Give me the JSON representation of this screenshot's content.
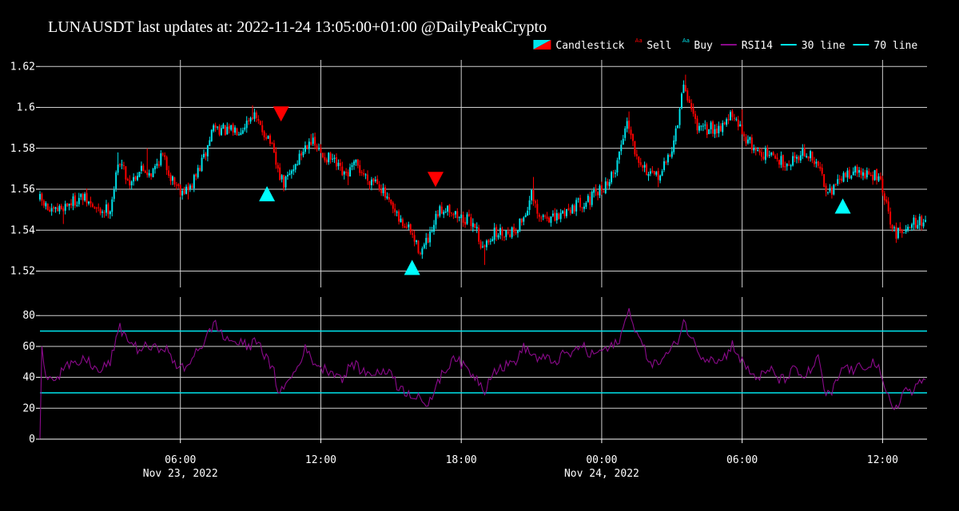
{
  "title": "LUNAUSDT last updates at: 2022-11-24 13:05:00+01:00 @DailyPeakCrypto",
  "legend": [
    {
      "label": "Candlestick",
      "kind": "candle"
    },
    {
      "label": "Sell",
      "kind": "sell"
    },
    {
      "label": "Buy",
      "kind": "buy"
    },
    {
      "label": "RSI14",
      "kind": "rsi"
    },
    {
      "label": "30 line",
      "kind": "hline"
    },
    {
      "label": "70 line",
      "kind": "hline"
    }
  ],
  "colors": {
    "background": "#000000",
    "up": "#00e5ee",
    "down": "#ff0000",
    "buy_marker": "#00ffff",
    "sell_marker": "#ff0000",
    "rsi": "#8b0a8b",
    "hline": "#00e5ee",
    "grid": "#cfcfcf",
    "text": "#ffffff"
  },
  "x_axis": {
    "ticks": [
      {
        "label": "06:00",
        "sub": "Nov 23, 2022",
        "h": 30
      },
      {
        "label": "12:00",
        "sub": "",
        "h": 36
      },
      {
        "label": "18:00",
        "sub": "",
        "h": 42
      },
      {
        "label": "00:00",
        "sub": "Nov 24, 2022",
        "h": 48
      },
      {
        "label": "06:00",
        "sub": "",
        "h": 54
      },
      {
        "label": "12:00",
        "sub": "",
        "h": 60
      }
    ]
  },
  "chart_data": [
    {
      "type": "candlestick",
      "name": "Candlestick",
      "x_range_hours": [
        24.0,
        61.9
      ],
      "x_unit": "hours since 2022-11-22 00:00",
      "ylim": [
        1.512,
        1.624
      ],
      "y_ticks": [
        "1.62",
        "1.6",
        "1.58",
        "1.56",
        "1.54",
        "1.52"
      ],
      "grid": true,
      "interval_minutes": 5,
      "close_path": [
        [
          24.0,
          1.555
        ],
        [
          24.5,
          1.548
        ],
        [
          25.2,
          1.553
        ],
        [
          25.8,
          1.556
        ],
        [
          26.5,
          1.549
        ],
        [
          27.0,
          1.551
        ],
        [
          27.4,
          1.575
        ],
        [
          27.8,
          1.563
        ],
        [
          28.3,
          1.57
        ],
        [
          28.8,
          1.568
        ],
        [
          29.2,
          1.577
        ],
        [
          29.6,
          1.566
        ],
        [
          30.0,
          1.56
        ],
        [
          30.4,
          1.56
        ],
        [
          30.8,
          1.57
        ],
        [
          31.1,
          1.578
        ],
        [
          31.4,
          1.591
        ],
        [
          32.0,
          1.588
        ],
        [
          32.6,
          1.59
        ],
        [
          33.1,
          1.597
        ],
        [
          33.4,
          1.59
        ],
        [
          33.8,
          1.585
        ],
        [
          34.1,
          1.571
        ],
        [
          34.4,
          1.562
        ],
        [
          34.8,
          1.57
        ],
        [
          35.2,
          1.578
        ],
        [
          35.5,
          1.585
        ],
        [
          36.0,
          1.577
        ],
        [
          36.5,
          1.574
        ],
        [
          37.0,
          1.566
        ],
        [
          37.5,
          1.572
        ],
        [
          38.0,
          1.565
        ],
        [
          38.4,
          1.565
        ],
        [
          38.8,
          1.555
        ],
        [
          39.3,
          1.545
        ],
        [
          39.8,
          1.54
        ],
        [
          40.1,
          1.532
        ],
        [
          40.3,
          1.53
        ],
        [
          40.7,
          1.537
        ],
        [
          41.0,
          1.548
        ],
        [
          41.4,
          1.552
        ],
        [
          41.8,
          1.547
        ],
        [
          42.2,
          1.545
        ],
        [
          42.6,
          1.543
        ],
        [
          42.9,
          1.53
        ],
        [
          43.3,
          1.538
        ],
        [
          43.8,
          1.539
        ],
        [
          44.3,
          1.54
        ],
        [
          44.7,
          1.547
        ],
        [
          45.0,
          1.557
        ],
        [
          45.3,
          1.545
        ],
        [
          45.6,
          1.547
        ],
        [
          46.0,
          1.545
        ],
        [
          46.5,
          1.55
        ],
        [
          47.0,
          1.553
        ],
        [
          47.5,
          1.555
        ],
        [
          48.0,
          1.56
        ],
        [
          48.5,
          1.567
        ],
        [
          48.8,
          1.58
        ],
        [
          49.1,
          1.595
        ],
        [
          49.4,
          1.58
        ],
        [
          49.8,
          1.571
        ],
        [
          50.2,
          1.565
        ],
        [
          50.6,
          1.569
        ],
        [
          51.0,
          1.58
        ],
        [
          51.3,
          1.595
        ],
        [
          51.5,
          1.612
        ],
        [
          51.8,
          1.6
        ],
        [
          52.2,
          1.588
        ],
        [
          52.6,
          1.59
        ],
        [
          53.0,
          1.59
        ],
        [
          53.5,
          1.596
        ],
        [
          53.9,
          1.59
        ],
        [
          54.3,
          1.583
        ],
        [
          54.7,
          1.578
        ],
        [
          55.1,
          1.577
        ],
        [
          55.6,
          1.574
        ],
        [
          56.0,
          1.573
        ],
        [
          56.5,
          1.578
        ],
        [
          56.9,
          1.576
        ],
        [
          57.3,
          1.57
        ],
        [
          57.6,
          1.561
        ],
        [
          57.9,
          1.56
        ],
        [
          58.3,
          1.566
        ],
        [
          58.7,
          1.569
        ],
        [
          59.1,
          1.568
        ],
        [
          59.5,
          1.566
        ],
        [
          59.8,
          1.567
        ],
        [
          60.1,
          1.555
        ],
        [
          60.4,
          1.54
        ],
        [
          60.7,
          1.538
        ],
        [
          61.0,
          1.543
        ],
        [
          61.5,
          1.544
        ],
        [
          61.9,
          1.544
        ]
      ],
      "spikes": [
        [
          25.0,
          1.543
        ],
        [
          26.9,
          1.546
        ],
        [
          27.3,
          1.578
        ],
        [
          28.6,
          1.58
        ],
        [
          30.3,
          1.555
        ],
        [
          33.1,
          1.601
        ],
        [
          34.4,
          1.56
        ],
        [
          35.6,
          1.587
        ],
        [
          37.2,
          1.562
        ],
        [
          40.3,
          1.526
        ],
        [
          43.0,
          1.523
        ],
        [
          45.1,
          1.566
        ],
        [
          49.2,
          1.598
        ],
        [
          50.4,
          1.561
        ],
        [
          51.6,
          1.616
        ],
        [
          54.0,
          1.599
        ],
        [
          57.9,
          1.557
        ],
        [
          60.6,
          1.535
        ]
      ]
    },
    {
      "type": "scatter",
      "name": "Buy",
      "marker": "triangle-up",
      "points": [
        [
          33.7,
          1.558
        ],
        [
          39.9,
          1.522
        ],
        [
          58.3,
          1.552
        ]
      ]
    },
    {
      "type": "scatter",
      "name": "Sell",
      "marker": "triangle-down",
      "points": [
        [
          34.3,
          1.597
        ],
        [
          40.9,
          1.565
        ]
      ]
    },
    {
      "type": "line",
      "name": "RSI14",
      "ylim": [
        0,
        92
      ],
      "y_ticks": [
        "80",
        "60",
        "40",
        "20",
        "0"
      ],
      "grid": true,
      "hlines": [
        {
          "name": "30 line",
          "value": 30
        },
        {
          "name": "70 line",
          "value": 70
        }
      ],
      "path": [
        [
          24.0,
          0
        ],
        [
          24.05,
          68
        ],
        [
          24.25,
          40
        ],
        [
          24.5,
          42
        ],
        [
          24.75,
          39
        ],
        [
          25.0,
          46
        ],
        [
          25.5,
          48
        ],
        [
          26.0,
          52
        ],
        [
          26.5,
          43
        ],
        [
          27.0,
          50
        ],
        [
          27.4,
          72
        ],
        [
          27.8,
          64
        ],
        [
          28.2,
          58
        ],
        [
          28.6,
          60
        ],
        [
          29.0,
          58
        ],
        [
          29.3,
          61
        ],
        [
          29.6,
          52
        ],
        [
          30.0,
          46
        ],
        [
          30.3,
          45
        ],
        [
          30.6,
          57
        ],
        [
          31.0,
          62
        ],
        [
          31.2,
          68
        ],
        [
          31.5,
          76
        ],
        [
          31.8,
          66
        ],
        [
          32.0,
          65
        ],
        [
          32.5,
          62
        ],
        [
          33.0,
          60
        ],
        [
          33.3,
          66
        ],
        [
          33.6,
          54
        ],
        [
          34.0,
          43
        ],
        [
          34.1,
          33
        ],
        [
          34.4,
          32
        ],
        [
          34.7,
          40
        ],
        [
          35.0,
          46
        ],
        [
          35.3,
          59
        ],
        [
          35.6,
          52
        ],
        [
          36.0,
          46
        ],
        [
          36.5,
          44
        ],
        [
          37.0,
          39
        ],
        [
          37.3,
          50
        ],
        [
          37.6,
          46
        ],
        [
          38.0,
          42
        ],
        [
          38.4,
          44
        ],
        [
          38.7,
          42
        ],
        [
          39.0,
          46
        ],
        [
          39.3,
          33
        ],
        [
          39.6,
          31
        ],
        [
          40.0,
          28
        ],
        [
          40.2,
          30
        ],
        [
          40.4,
          22
        ],
        [
          40.5,
          18
        ],
        [
          40.7,
          25
        ],
        [
          40.9,
          35
        ],
        [
          41.1,
          40
        ],
        [
          41.4,
          46
        ],
        [
          41.7,
          55
        ],
        [
          42.0,
          48
        ],
        [
          42.3,
          45
        ],
        [
          42.6,
          40
        ],
        [
          42.9,
          35
        ],
        [
          43.0,
          31
        ],
        [
          43.3,
          44
        ],
        [
          43.7,
          46
        ],
        [
          44.0,
          48
        ],
        [
          44.4,
          52
        ],
        [
          44.7,
          60
        ],
        [
          45.0,
          55
        ],
        [
          45.3,
          52
        ],
        [
          45.6,
          52
        ],
        [
          46.0,
          50
        ],
        [
          46.4,
          55
        ],
        [
          46.8,
          55
        ],
        [
          47.1,
          62
        ],
        [
          47.5,
          54
        ],
        [
          47.9,
          57
        ],
        [
          48.2,
          58
        ],
        [
          48.5,
          60
        ],
        [
          48.8,
          66
        ],
        [
          49.1,
          80
        ],
        [
          49.2,
          85
        ],
        [
          49.4,
          72
        ],
        [
          49.7,
          62
        ],
        [
          50.0,
          52
        ],
        [
          50.3,
          48
        ],
        [
          50.6,
          52
        ],
        [
          51.0,
          58
        ],
        [
          51.3,
          66
        ],
        [
          51.5,
          77
        ],
        [
          51.8,
          66
        ],
        [
          52.1,
          58
        ],
        [
          52.4,
          52
        ],
        [
          52.7,
          54
        ],
        [
          53.0,
          50
        ],
        [
          53.3,
          54
        ],
        [
          53.6,
          62
        ],
        [
          53.9,
          52
        ],
        [
          54.3,
          44
        ],
        [
          54.6,
          40
        ],
        [
          55.0,
          42
        ],
        [
          55.3,
          45
        ],
        [
          55.6,
          38
        ],
        [
          55.9,
          40
        ],
        [
          56.2,
          45
        ],
        [
          56.6,
          40
        ],
        [
          57.0,
          46
        ],
        [
          57.3,
          53
        ],
        [
          57.5,
          30
        ],
        [
          57.8,
          28
        ],
        [
          58.1,
          40
        ],
        [
          58.4,
          48
        ],
        [
          58.7,
          44
        ],
        [
          59.0,
          46
        ],
        [
          59.3,
          48
        ],
        [
          59.6,
          50
        ],
        [
          59.8,
          47
        ],
        [
          60.0,
          35
        ],
        [
          60.2,
          28
        ],
        [
          60.5,
          20
        ],
        [
          60.7,
          24
        ],
        [
          61.0,
          33
        ],
        [
          61.3,
          30
        ],
        [
          61.6,
          36
        ],
        [
          61.9,
          40
        ]
      ]
    }
  ]
}
